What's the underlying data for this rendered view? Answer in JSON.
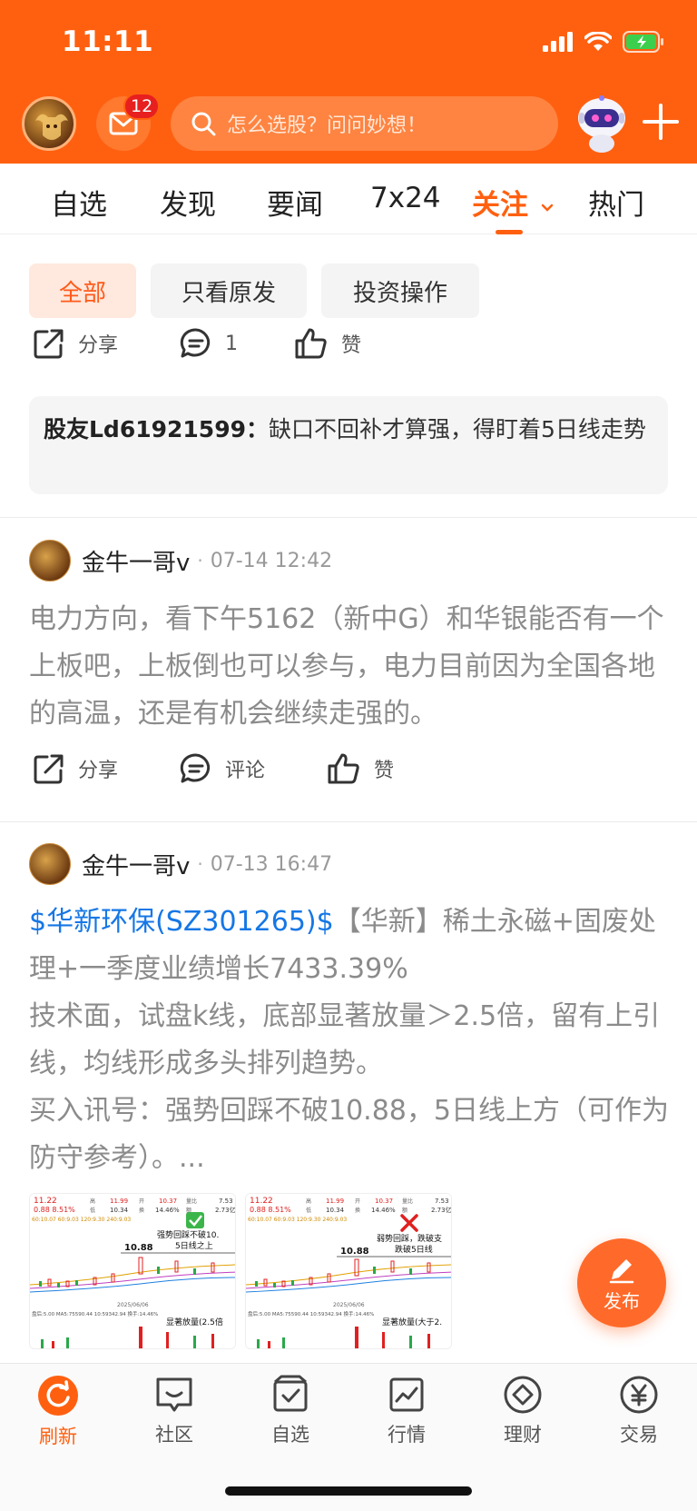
{
  "status_bar": {
    "time": "11:11"
  },
  "header": {
    "mail_badge": "12",
    "search_placeholder": "怎么选股？问问妙想！",
    "accent_color": "#ff6010"
  },
  "tabs": [
    {
      "label": "自选"
    },
    {
      "label": "发现"
    },
    {
      "label": "要闻"
    },
    {
      "label": "7x24"
    },
    {
      "label": "关注",
      "active": true
    },
    {
      "label": "热门"
    }
  ],
  "filters": [
    {
      "label": "全部",
      "active": true
    },
    {
      "label": "只看原发"
    },
    {
      "label": "投资操作"
    }
  ],
  "post0": {
    "share": "分享",
    "comment": "1",
    "like": "赞",
    "quote_user": "股友Ld61921599：",
    "quote_text": "缺口不回补才算强，得盯着5日线走势"
  },
  "post1": {
    "author": "金牛一哥v",
    "time": "07-14 12:42",
    "body": "电力方向，看下午5162（新中G）和华银能否有一个上板吧，上板倒也可以参与，电力目前因为全国各地的高温，还是有机会继续走强的。",
    "share": "分享",
    "comment": "评论",
    "like": "赞"
  },
  "post2": {
    "author": "金牛一哥v",
    "time": "07-13 16:47",
    "ticker": "$华新环保(SZ301265)$",
    "line1_rest": "【华新】稀土永磁+固废处理+一季度业绩增长7433.39%",
    "line2": "技术面，试盘k线，底部显著放量＞2.5倍，留有上引线，均线形成多头排列趋势。",
    "line3": "买入讯号：强势回踩不破10.88，5日线上方（可作为防守参考）。...",
    "thumb1": {
      "price": "11.22",
      "change": "0.88  8.51%",
      "hi_label": "高",
      "hi": "11.99",
      "open_label": "开",
      "open": "10.37",
      "vol_label": "量比",
      "vol": "7.53",
      "lo_label": "低",
      "lo": "10.34",
      "turn_label": "换",
      "turn": "14.46%",
      "amt_label": "额",
      "amt": "2.73亿",
      "ma_line": "60:10.07  60:9.03  120:9.30  240:9.03",
      "note": "强势回踩不破10.",
      "note2": "5日线之上",
      "level": "10.88",
      "date": "2025/06/06",
      "vol_note": "显著放量(2.5倍",
      "legend": "盘后:5.00  MA5:75590.44  10:59342.94  换手:14.46%"
    },
    "thumb2": {
      "price": "11.22",
      "change": "0.88  8.51%",
      "hi_label": "高",
      "hi": "11.99",
      "open_label": "开",
      "open": "10.37",
      "vol_label": "量比",
      "vol": "7.53",
      "lo_label": "低",
      "lo": "10.34",
      "turn_label": "换",
      "turn": "14.46%",
      "amt_label": "额",
      "amt": "2.73亿",
      "ma_line": "60:10.07  60:9.03  120:9.30  240:9.03",
      "note": "弱势回踩，跌破支",
      "note2": "跌破5日线",
      "level": "10.88",
      "date": "2025/06/06",
      "vol_note": "显著放量(大于2.",
      "legend": "盘后:5.00  MA5:75590.44  10:59342.94  换手:14.46%"
    }
  },
  "fab": {
    "label": "发布"
  },
  "bottom_nav": [
    {
      "label": "刷新",
      "active": true
    },
    {
      "label": "社区"
    },
    {
      "label": "自选"
    },
    {
      "label": "行情"
    },
    {
      "label": "理财"
    },
    {
      "label": "交易"
    }
  ]
}
